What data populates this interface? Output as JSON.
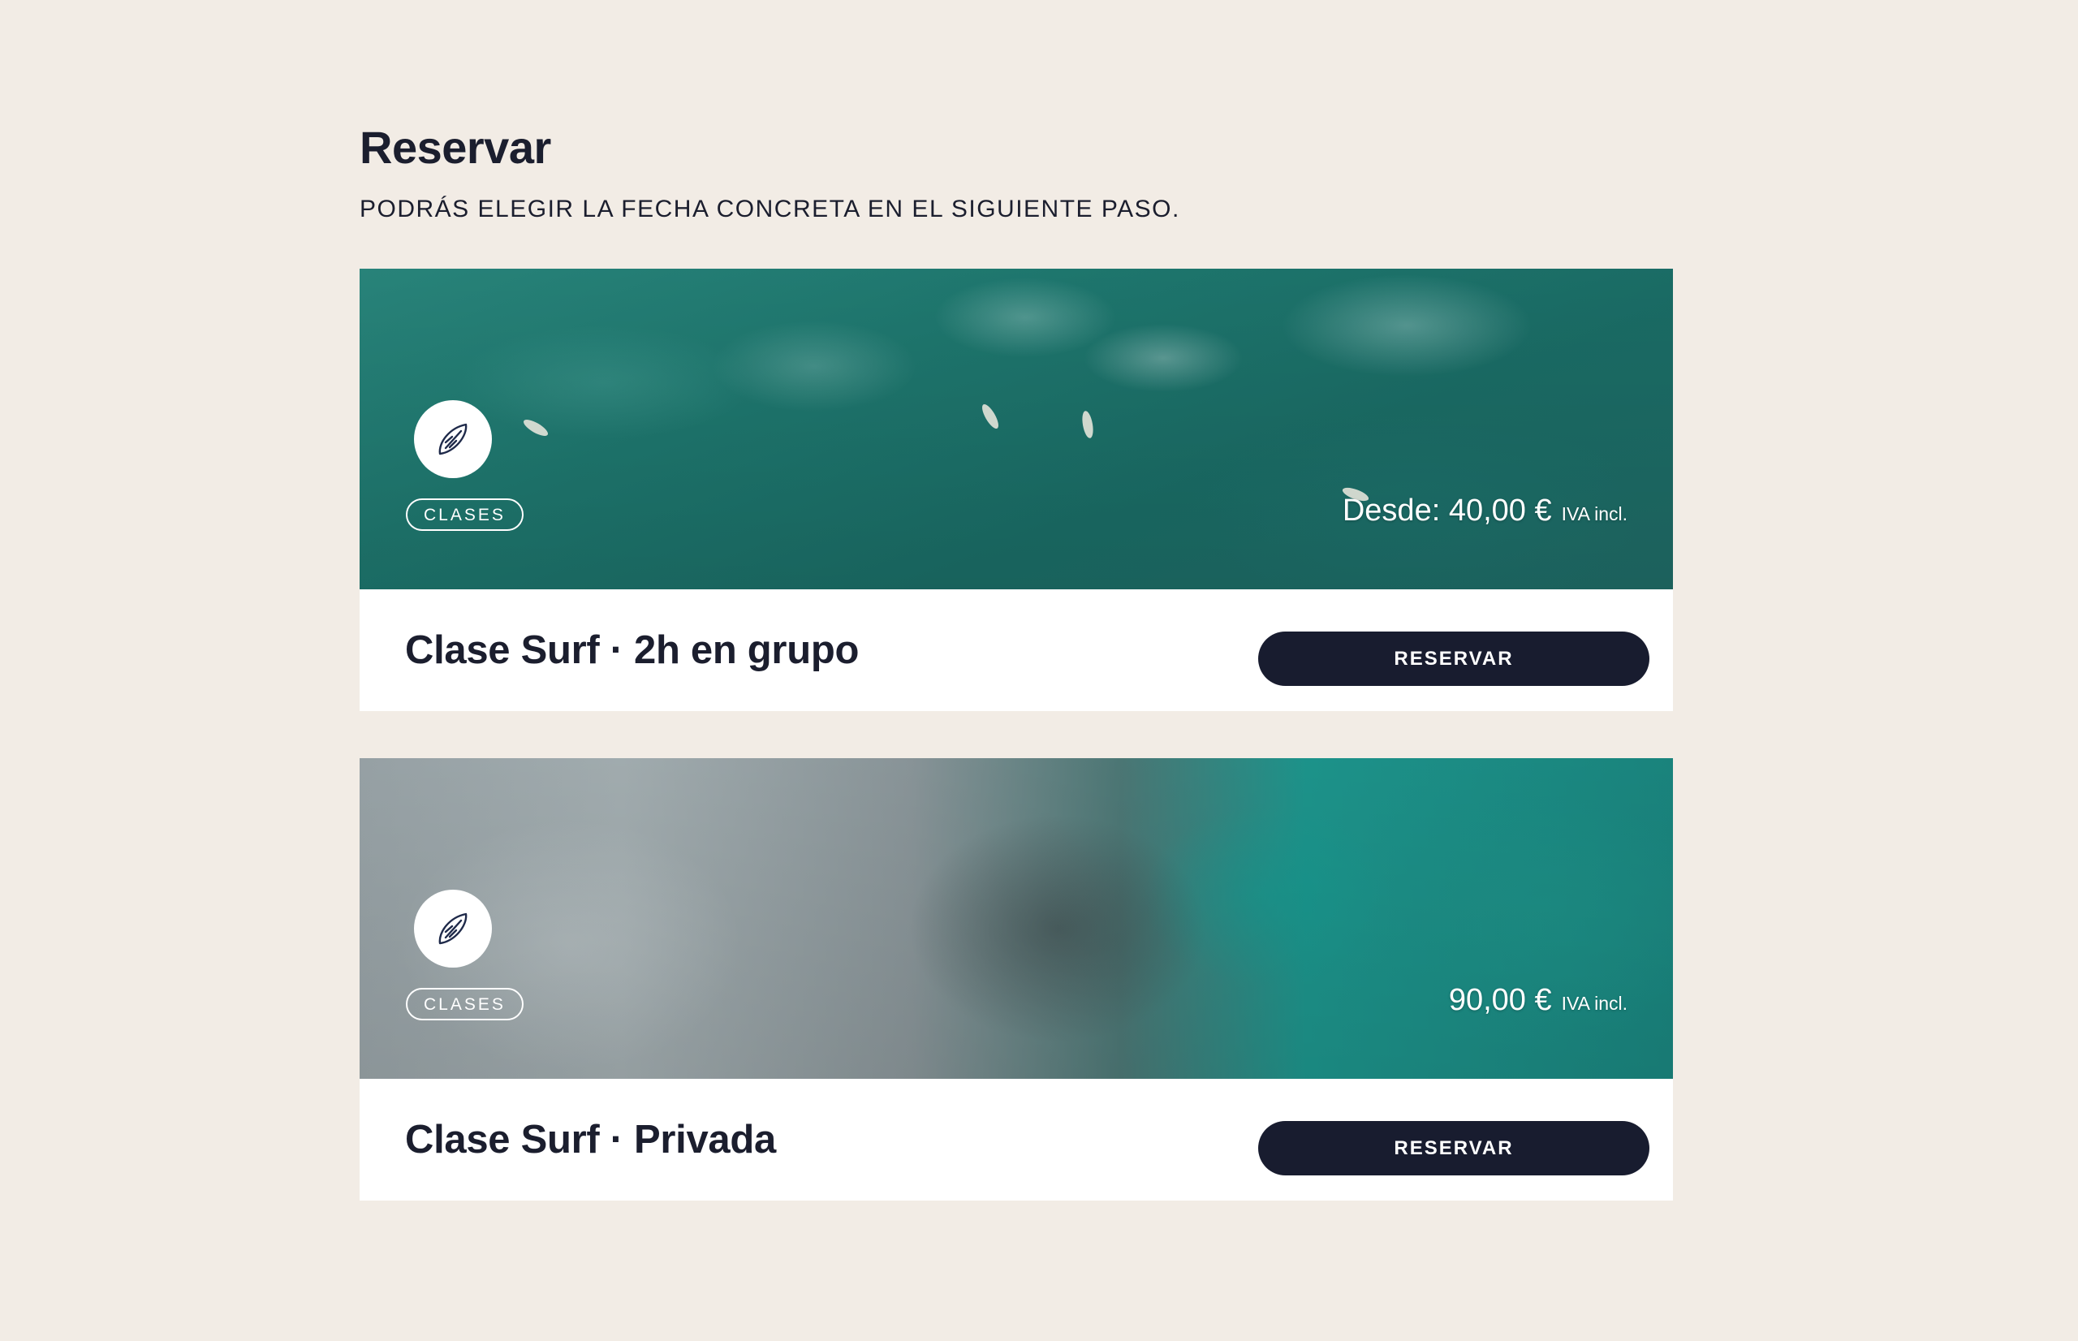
{
  "header": {
    "title": "Reservar",
    "subtitle": "PODRÁS ELEGIR LA FECHA CONCRETA EN EL SIGUIENTE PASO."
  },
  "offers": [
    {
      "category": "CLASES",
      "category_icon": "surfboard-icon",
      "price": "Desde: 40,00 €",
      "tax_note": "IVA incl.",
      "title": "Clase Surf · 2h en grupo",
      "button_label": "RESERVAR"
    },
    {
      "category": "CLASES",
      "category_icon": "surfboard-icon",
      "price": "90,00 €",
      "tax_note": "IVA incl.",
      "title": "Clase Surf · Privada",
      "button_label": "RESERVAR"
    }
  ],
  "colors": {
    "background": "#f2ece5",
    "text": "#1b1e2e",
    "button": "#181c2f",
    "card": "#ffffff"
  }
}
